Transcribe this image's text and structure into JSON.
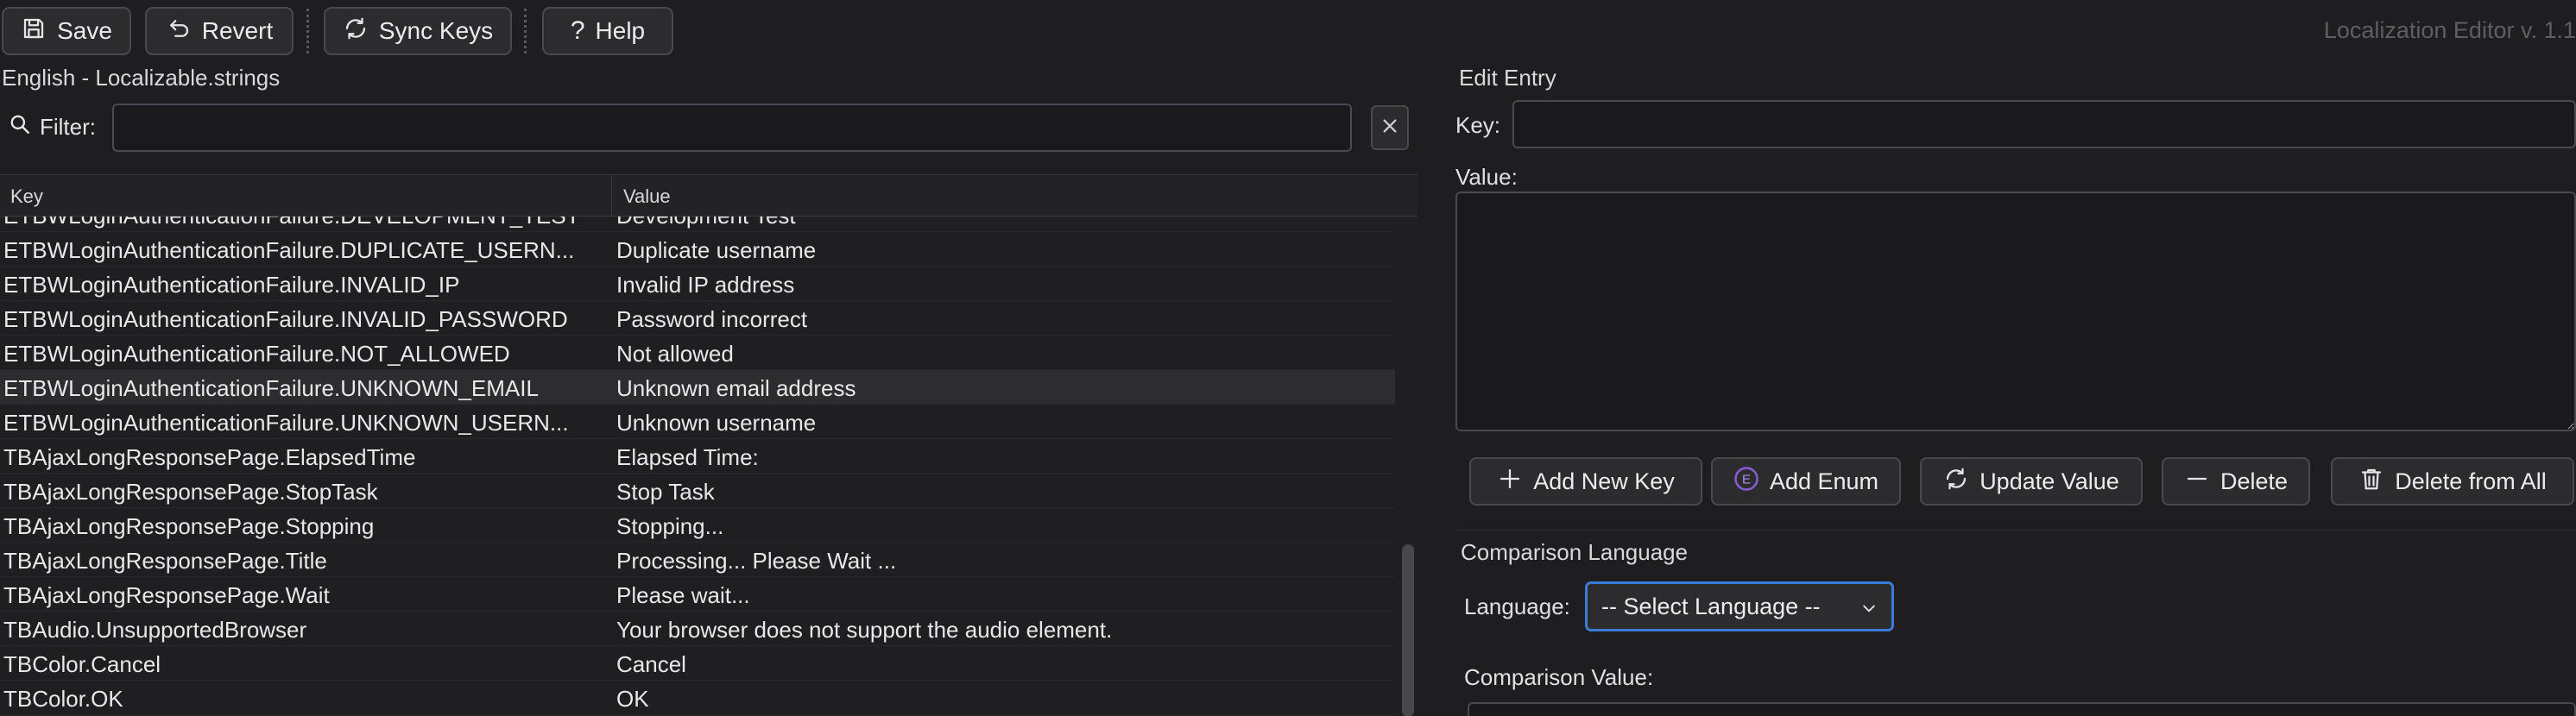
{
  "toolbar": {
    "save_label": "Save",
    "revert_label": "Revert",
    "sync_label": "Sync Keys",
    "help_label": "Help",
    "version": "Localization Editor v. 1.1"
  },
  "left_panel": {
    "title": "English - Localizable.strings",
    "filter_label": "Filter:",
    "filter_value": "",
    "columns": {
      "key": "Key",
      "value": "Value"
    },
    "rows": [
      {
        "key": "ETBWLoginAuthenticationFailure.DEVELOPMENT_TEST",
        "value": "Development Test"
      },
      {
        "key": "ETBWLoginAuthenticationFailure.DUPLICATE_USERN...",
        "value": "Duplicate username"
      },
      {
        "key": "ETBWLoginAuthenticationFailure.INVALID_IP",
        "value": "Invalid IP address"
      },
      {
        "key": "ETBWLoginAuthenticationFailure.INVALID_PASSWORD",
        "value": "Password incorrect"
      },
      {
        "key": "ETBWLoginAuthenticationFailure.NOT_ALLOWED",
        "value": "Not allowed"
      },
      {
        "key": "ETBWLoginAuthenticationFailure.UNKNOWN_EMAIL",
        "value": "Unknown email address"
      },
      {
        "key": "ETBWLoginAuthenticationFailure.UNKNOWN_USERN...",
        "value": "Unknown username"
      },
      {
        "key": "TBAjaxLongResponsePage.ElapsedTime",
        "value": "Elapsed Time:"
      },
      {
        "key": "TBAjaxLongResponsePage.StopTask",
        "value": "Stop Task"
      },
      {
        "key": "TBAjaxLongResponsePage.Stopping",
        "value": "Stopping..."
      },
      {
        "key": "TBAjaxLongResponsePage.Title",
        "value": "Processing... Please Wait ..."
      },
      {
        "key": "TBAjaxLongResponsePage.Wait",
        "value": "Please wait..."
      },
      {
        "key": "TBAudio.UnsupportedBrowser",
        "value": "Your browser does not support the audio element."
      },
      {
        "key": "TBColor.Cancel",
        "value": "Cancel"
      },
      {
        "key": "TBColor.OK",
        "value": "OK"
      }
    ]
  },
  "edit_entry": {
    "title": "Edit Entry",
    "key_label": "Key:",
    "key_value": "",
    "value_label": "Value:",
    "value_text": "",
    "buttons": {
      "add_new_key": "Add New Key",
      "add_enum": "Add Enum",
      "update_value": "Update Value",
      "delete": "Delete",
      "delete_from_all": "Delete from All"
    },
    "enum_badge": "E"
  },
  "comparison": {
    "title": "Comparison Language",
    "language_label": "Language:",
    "language_selected": "-- Select Language --",
    "value_label": "Comparison Value:"
  },
  "colors": {
    "background": "#1e1e20",
    "focus_border": "#3d7bd9",
    "enum_badge": "#8a5cd6"
  }
}
